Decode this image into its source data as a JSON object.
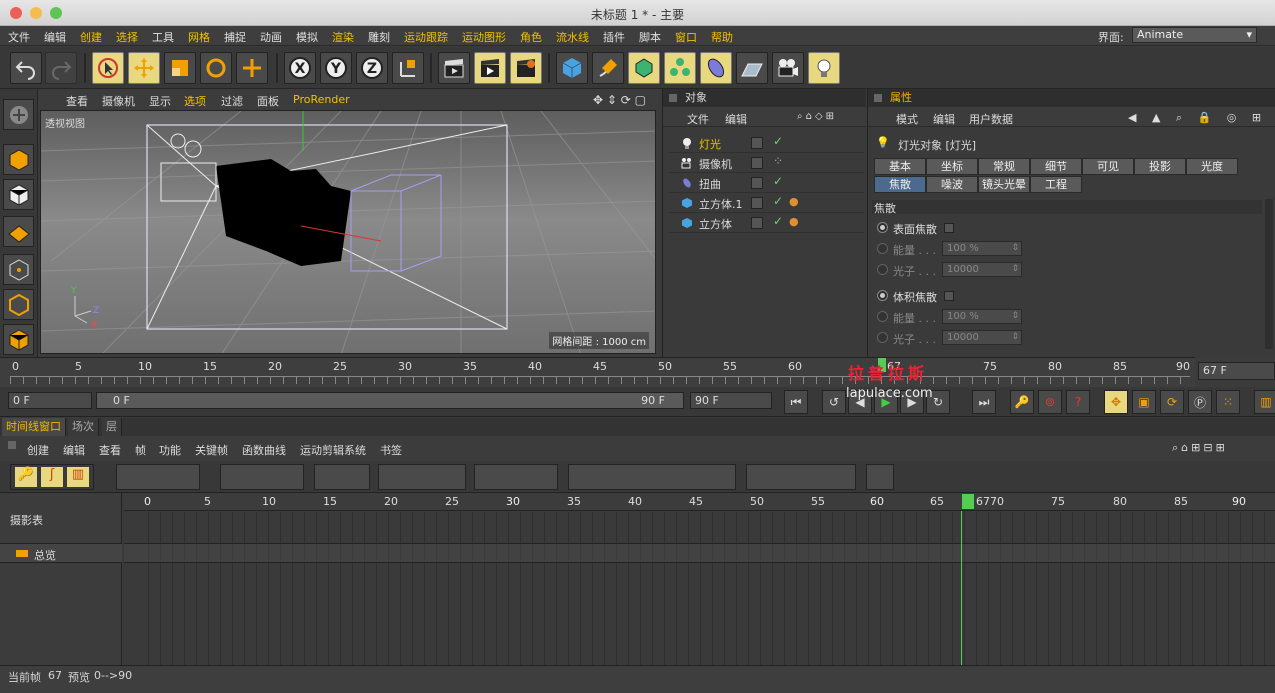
{
  "window": {
    "title": "未标题 1 * - 主要"
  },
  "menubar": {
    "items": [
      "文件",
      "编辑",
      "创建",
      "选择",
      "工具",
      "网格",
      "捕捉",
      "动画",
      "模拟",
      "渲染",
      "雕刻",
      "运动跟踪",
      "运动图形",
      "角色",
      "流水线",
      "插件",
      "脚本",
      "窗口",
      "帮助"
    ],
    "layout_label": "界面:",
    "layout_value": "Animate"
  },
  "viewport": {
    "menu": [
      "查看",
      "摄像机",
      "显示",
      "选项",
      "过滤",
      "面板",
      "ProRender"
    ],
    "label": "透视视图",
    "grid_info": "网格间距 : 1000 cm"
  },
  "objects": {
    "title": "对象",
    "menu": [
      "文件",
      "编辑"
    ],
    "items": [
      {
        "name": "灯光",
        "icon": "light-icon",
        "selected": true
      },
      {
        "name": "摄像机",
        "icon": "camera-icon"
      },
      {
        "name": "扭曲",
        "icon": "bend-icon"
      },
      {
        "name": "立方体.1",
        "icon": "cube-icon"
      },
      {
        "name": "立方体",
        "icon": "cube-icon"
      }
    ]
  },
  "attributes": {
    "title": "属性",
    "menu": [
      "模式",
      "编辑",
      "用户数据"
    ],
    "object_title": "灯光对象 [灯光]",
    "tabs_row1": [
      "基本",
      "坐标",
      "常规",
      "细节",
      "可见",
      "投影",
      "光度"
    ],
    "tabs_row2": [
      "焦散",
      "噪波",
      "镜头光晕",
      "工程"
    ],
    "section": "焦散",
    "surface_caustics": "表面焦散",
    "volume_caustics": "体积焦散",
    "energy_label": "能量 . . .",
    "photons_label": "光子 . . .",
    "energy_value": "100 %",
    "photons_value": "10000"
  },
  "ruler": {
    "ticks": [
      "0",
      "5",
      "10",
      "15",
      "20",
      "25",
      "30",
      "35",
      "40",
      "45",
      "50",
      "55",
      "60",
      "67",
      "75",
      "80",
      "85",
      "90"
    ],
    "current_frame": "67 F",
    "watermark": "拉普拉斯",
    "watermark_url": "lapulace.com"
  },
  "transport": {
    "start": "0 F",
    "range_start": "0 F",
    "range_end": "90 F",
    "end": "90 F"
  },
  "timeline": {
    "tabs": [
      "时间线窗口",
      "场次",
      "层"
    ],
    "menu": [
      "创建",
      "编辑",
      "查看",
      "帧",
      "功能",
      "关键帧",
      "函数曲线",
      "运动剪辑系统",
      "书签"
    ],
    "ticks": [
      "0",
      "5",
      "10",
      "15",
      "20",
      "25",
      "30",
      "35",
      "40",
      "45",
      "50",
      "55",
      "60",
      "65",
      "67",
      "70",
      "75",
      "80",
      "85",
      "90"
    ],
    "left_header": "摄影表",
    "summary": "总览"
  },
  "status": {
    "current_label": "当前帧",
    "current_value": "67",
    "preview_label": "预览",
    "preview_value": "0-->90"
  }
}
